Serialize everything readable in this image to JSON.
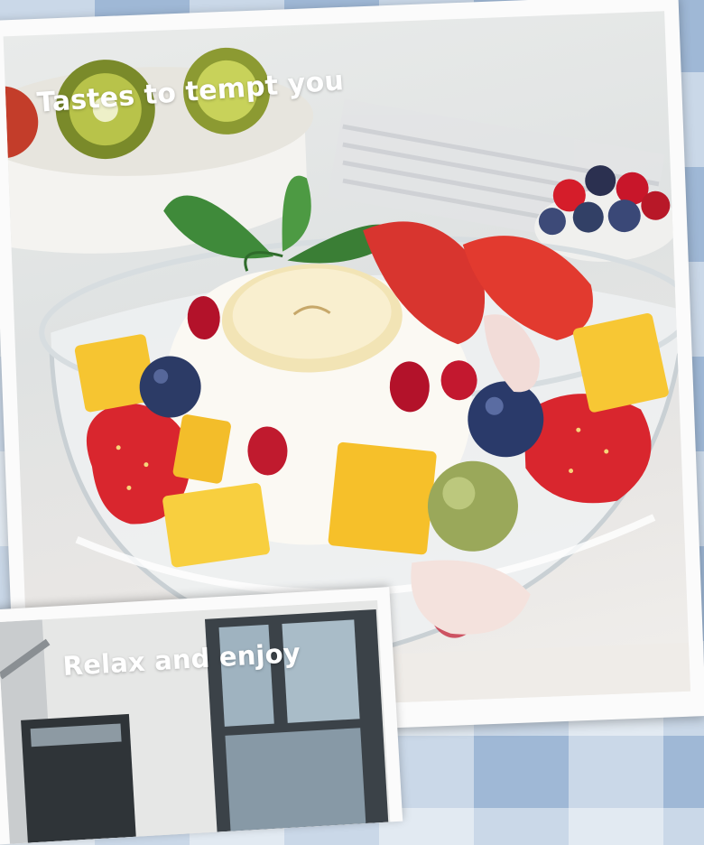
{
  "captions": {
    "main": "Tastes to tempt you",
    "second": "Relax and enjoy"
  },
  "colors": {
    "background_blue": "#9fb8d6",
    "card_white": "#fbfbfb",
    "caption_text": "#ffffff",
    "strawberry": "#d9262e",
    "mango": "#f6c531",
    "blueberry": "#2c3b66",
    "pomegranate": "#b3122a",
    "mint": "#3f8a3a",
    "yogurt": "#fbf9f3"
  }
}
